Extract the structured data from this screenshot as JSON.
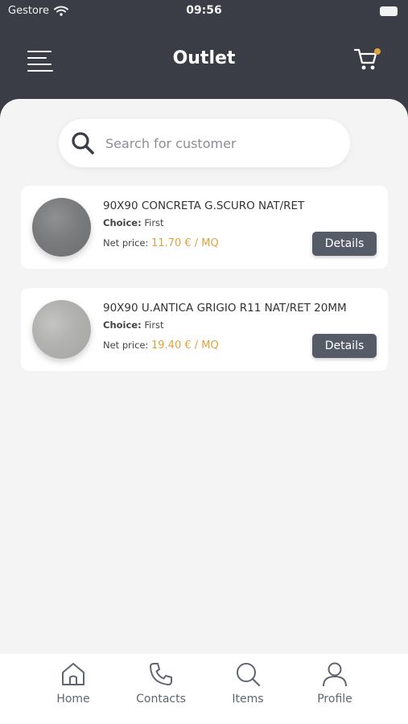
{
  "status_bar": {
    "carrier": "Gestore",
    "time": "09:56"
  },
  "header": {
    "title": "Outlet",
    "menu_icon": "menu-icon",
    "cart_icon": "cart-icon",
    "cart_badge_color": "#e0a23c"
  },
  "search": {
    "placeholder": "Search for customer",
    "icon": "search-icon"
  },
  "products": [
    {
      "title": "90X90 CONCRETA G.SCURO NAT/RET",
      "choice_label": "Choice:",
      "choice_value": "First",
      "price_label": "Net price:",
      "price_value": "11.70 € / MQ",
      "details_label": "Details"
    },
    {
      "title": "90X90 U.ANTICA GRIGIO R11 NAT/RET 20MM",
      "choice_label": "Choice:",
      "choice_value": "First",
      "price_label": "Net price:",
      "price_value": "19.40 € / MQ",
      "details_label": "Details"
    }
  ],
  "tabbar": {
    "items": [
      {
        "label": "Home",
        "icon": "home-icon"
      },
      {
        "label": "Contacts",
        "icon": "phone-icon"
      },
      {
        "label": "Items",
        "icon": "search-icon"
      },
      {
        "label": "Profile",
        "icon": "profile-icon"
      }
    ]
  },
  "colors": {
    "header_bg": "#3a3d45",
    "accent": "#e0a23c",
    "button_bg": "#555b67"
  }
}
